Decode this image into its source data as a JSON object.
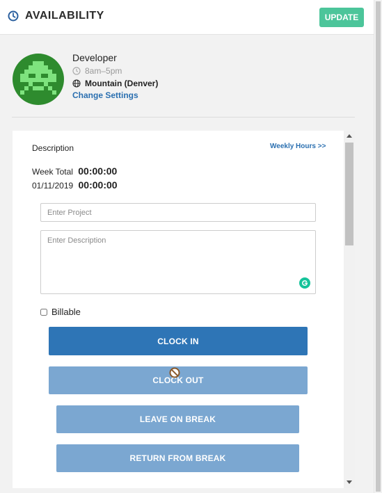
{
  "header": {
    "title": "AVAILABILITY",
    "update_label": "UPDATE",
    "icon": "clock-icon",
    "accent_color": "#4cc59a"
  },
  "profile": {
    "role": "Developer",
    "hours": "8am–5pm",
    "timezone": "Mountain (Denver)",
    "change_settings": "Change Settings",
    "avatar_color": "#2e8b2e"
  },
  "panel": {
    "description_label": "Description",
    "weekly_hours_link": "Weekly Hours >>",
    "week_total_label": "Week Total",
    "week_total_value": "00:00:00",
    "date_label": "01/11/2019",
    "date_value": "00:00:00",
    "project_placeholder": "Enter Project",
    "description_placeholder": "Enter Description",
    "billable_label": "Billable",
    "billable_checked": false
  },
  "buttons": {
    "clock_in": "CLOCK IN",
    "clock_out": "CLOCK OUT",
    "leave_on_break": "LEAVE ON BREAK",
    "return_from_break": "RETURN FROM BREAK",
    "primary_color": "#2e75b6",
    "disabled_color": "#7ba7d1"
  }
}
